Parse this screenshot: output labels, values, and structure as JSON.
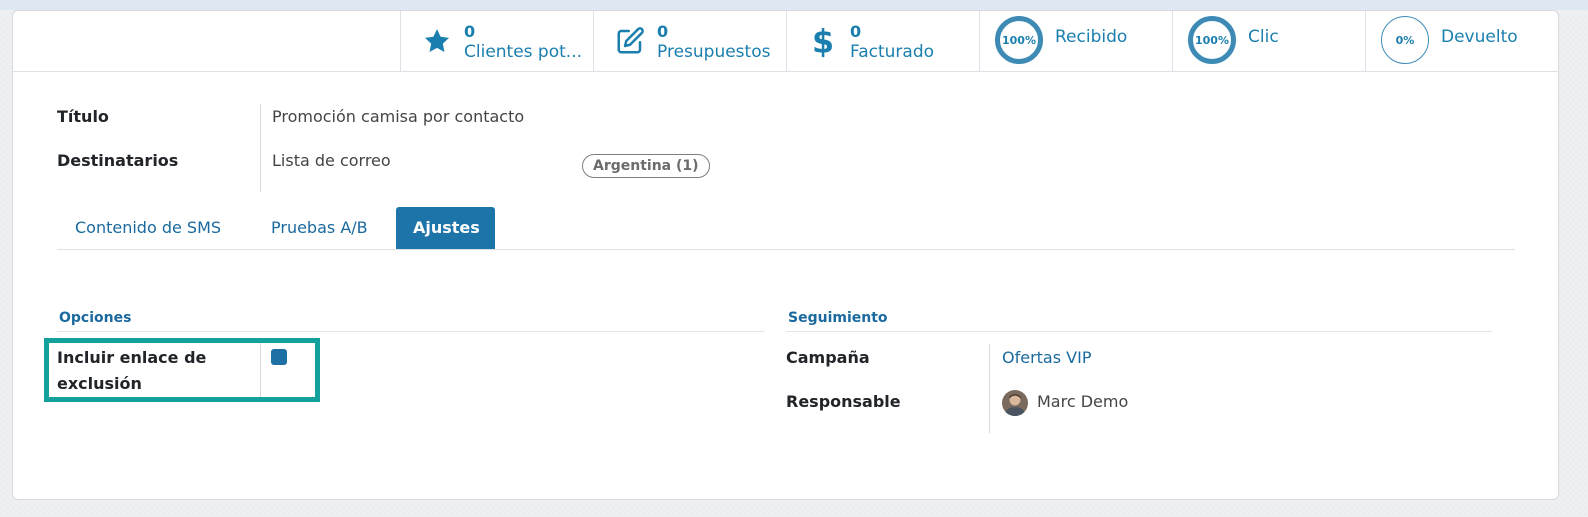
{
  "smart_buttons": [
    {
      "icon": "star-icon",
      "value": "0",
      "label": "Clientes pot..."
    },
    {
      "icon": "edit-icon",
      "value": "0",
      "label": "Presupuestos"
    },
    {
      "icon": "dollar-icon",
      "value": "0",
      "label": "Facturado"
    }
  ],
  "stat_buttons": [
    {
      "ring_value": "100%",
      "label": "Recibido",
      "percent": 100
    },
    {
      "ring_value": "100%",
      "label": "Clic",
      "percent": 100
    },
    {
      "ring_value": "0%",
      "label": "Devuelto",
      "percent": 0
    }
  ],
  "fields": {
    "title_label": "Título",
    "title_value": "Promoción camisa por contacto",
    "recipients_label": "Destinatarios",
    "recipients_value": "Lista de correo",
    "recipients_tag": "Argentina (1)"
  },
  "tabs": [
    {
      "label": "Contenido de SMS",
      "active": false
    },
    {
      "label": "Pruebas A/B",
      "active": false
    },
    {
      "label": "Ajustes",
      "active": true
    }
  ],
  "options": {
    "section_title": "Opciones",
    "optout_label": "Incluir enlace de exclusión",
    "optout_checked": true
  },
  "tracking": {
    "section_title": "Seguimiento",
    "campaign_label": "Campaña",
    "campaign_value": "Ofertas VIP",
    "responsible_label": "Responsable",
    "responsible_value": "Marc Demo"
  },
  "colors": {
    "accent": "#1a7fae",
    "active_tab": "#1c74a9",
    "highlight": "#12a29b",
    "checkbox": "#1e6fa3"
  }
}
